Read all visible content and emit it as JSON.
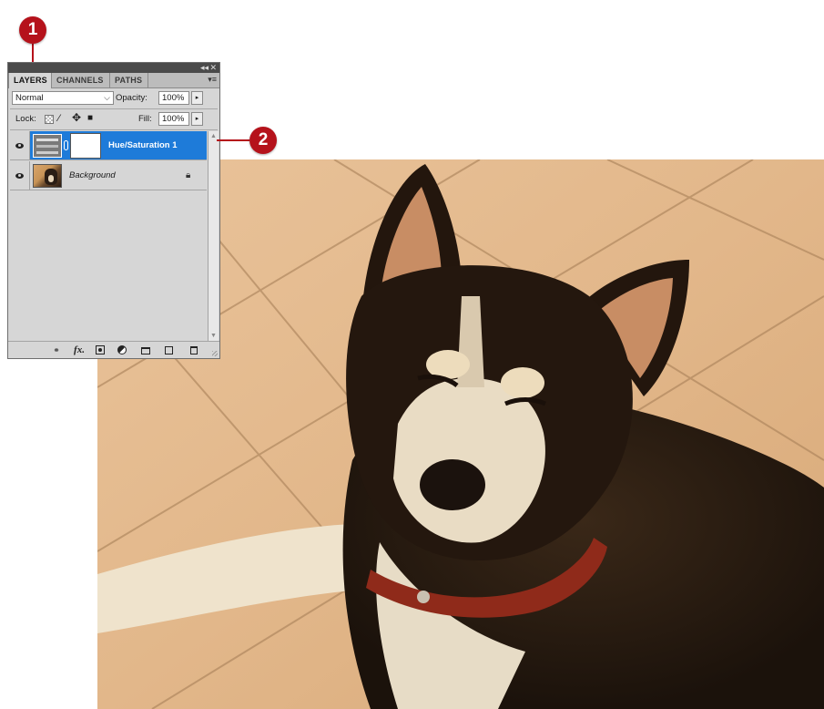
{
  "callouts": {
    "first": "1",
    "second": "2"
  },
  "panel": {
    "collapse_glyph": "◂◂",
    "close_glyph": "✕",
    "menu_glyph": "▾≡",
    "tabs": [
      {
        "label": "LAYERS",
        "active": true
      },
      {
        "label": "CHANNELS",
        "active": false
      },
      {
        "label": "PATHS",
        "active": false
      }
    ],
    "blend_mode": "Normal",
    "opacity_label": "Opacity:",
    "opacity_value": "100%",
    "lock_label": "Lock:",
    "fill_label": "Fill:",
    "fill_value": "100%",
    "arrow_glyph": "▸",
    "layers": [
      {
        "name": "Hue/Saturation 1",
        "selected": true,
        "type": "adjustment"
      },
      {
        "name": "Background",
        "selected": false,
        "type": "image",
        "locked": true
      }
    ],
    "bottom_icons": [
      "link-layers-icon",
      "fx-icon",
      "add-mask-icon",
      "adjustment-layer-icon",
      "new-group-icon",
      "new-layer-icon",
      "trash-icon"
    ],
    "fx_label": "fx."
  },
  "colors": {
    "selection": "#1e7bd9",
    "callout": "#b5121b",
    "panel_bg": "#d6d6d6"
  }
}
